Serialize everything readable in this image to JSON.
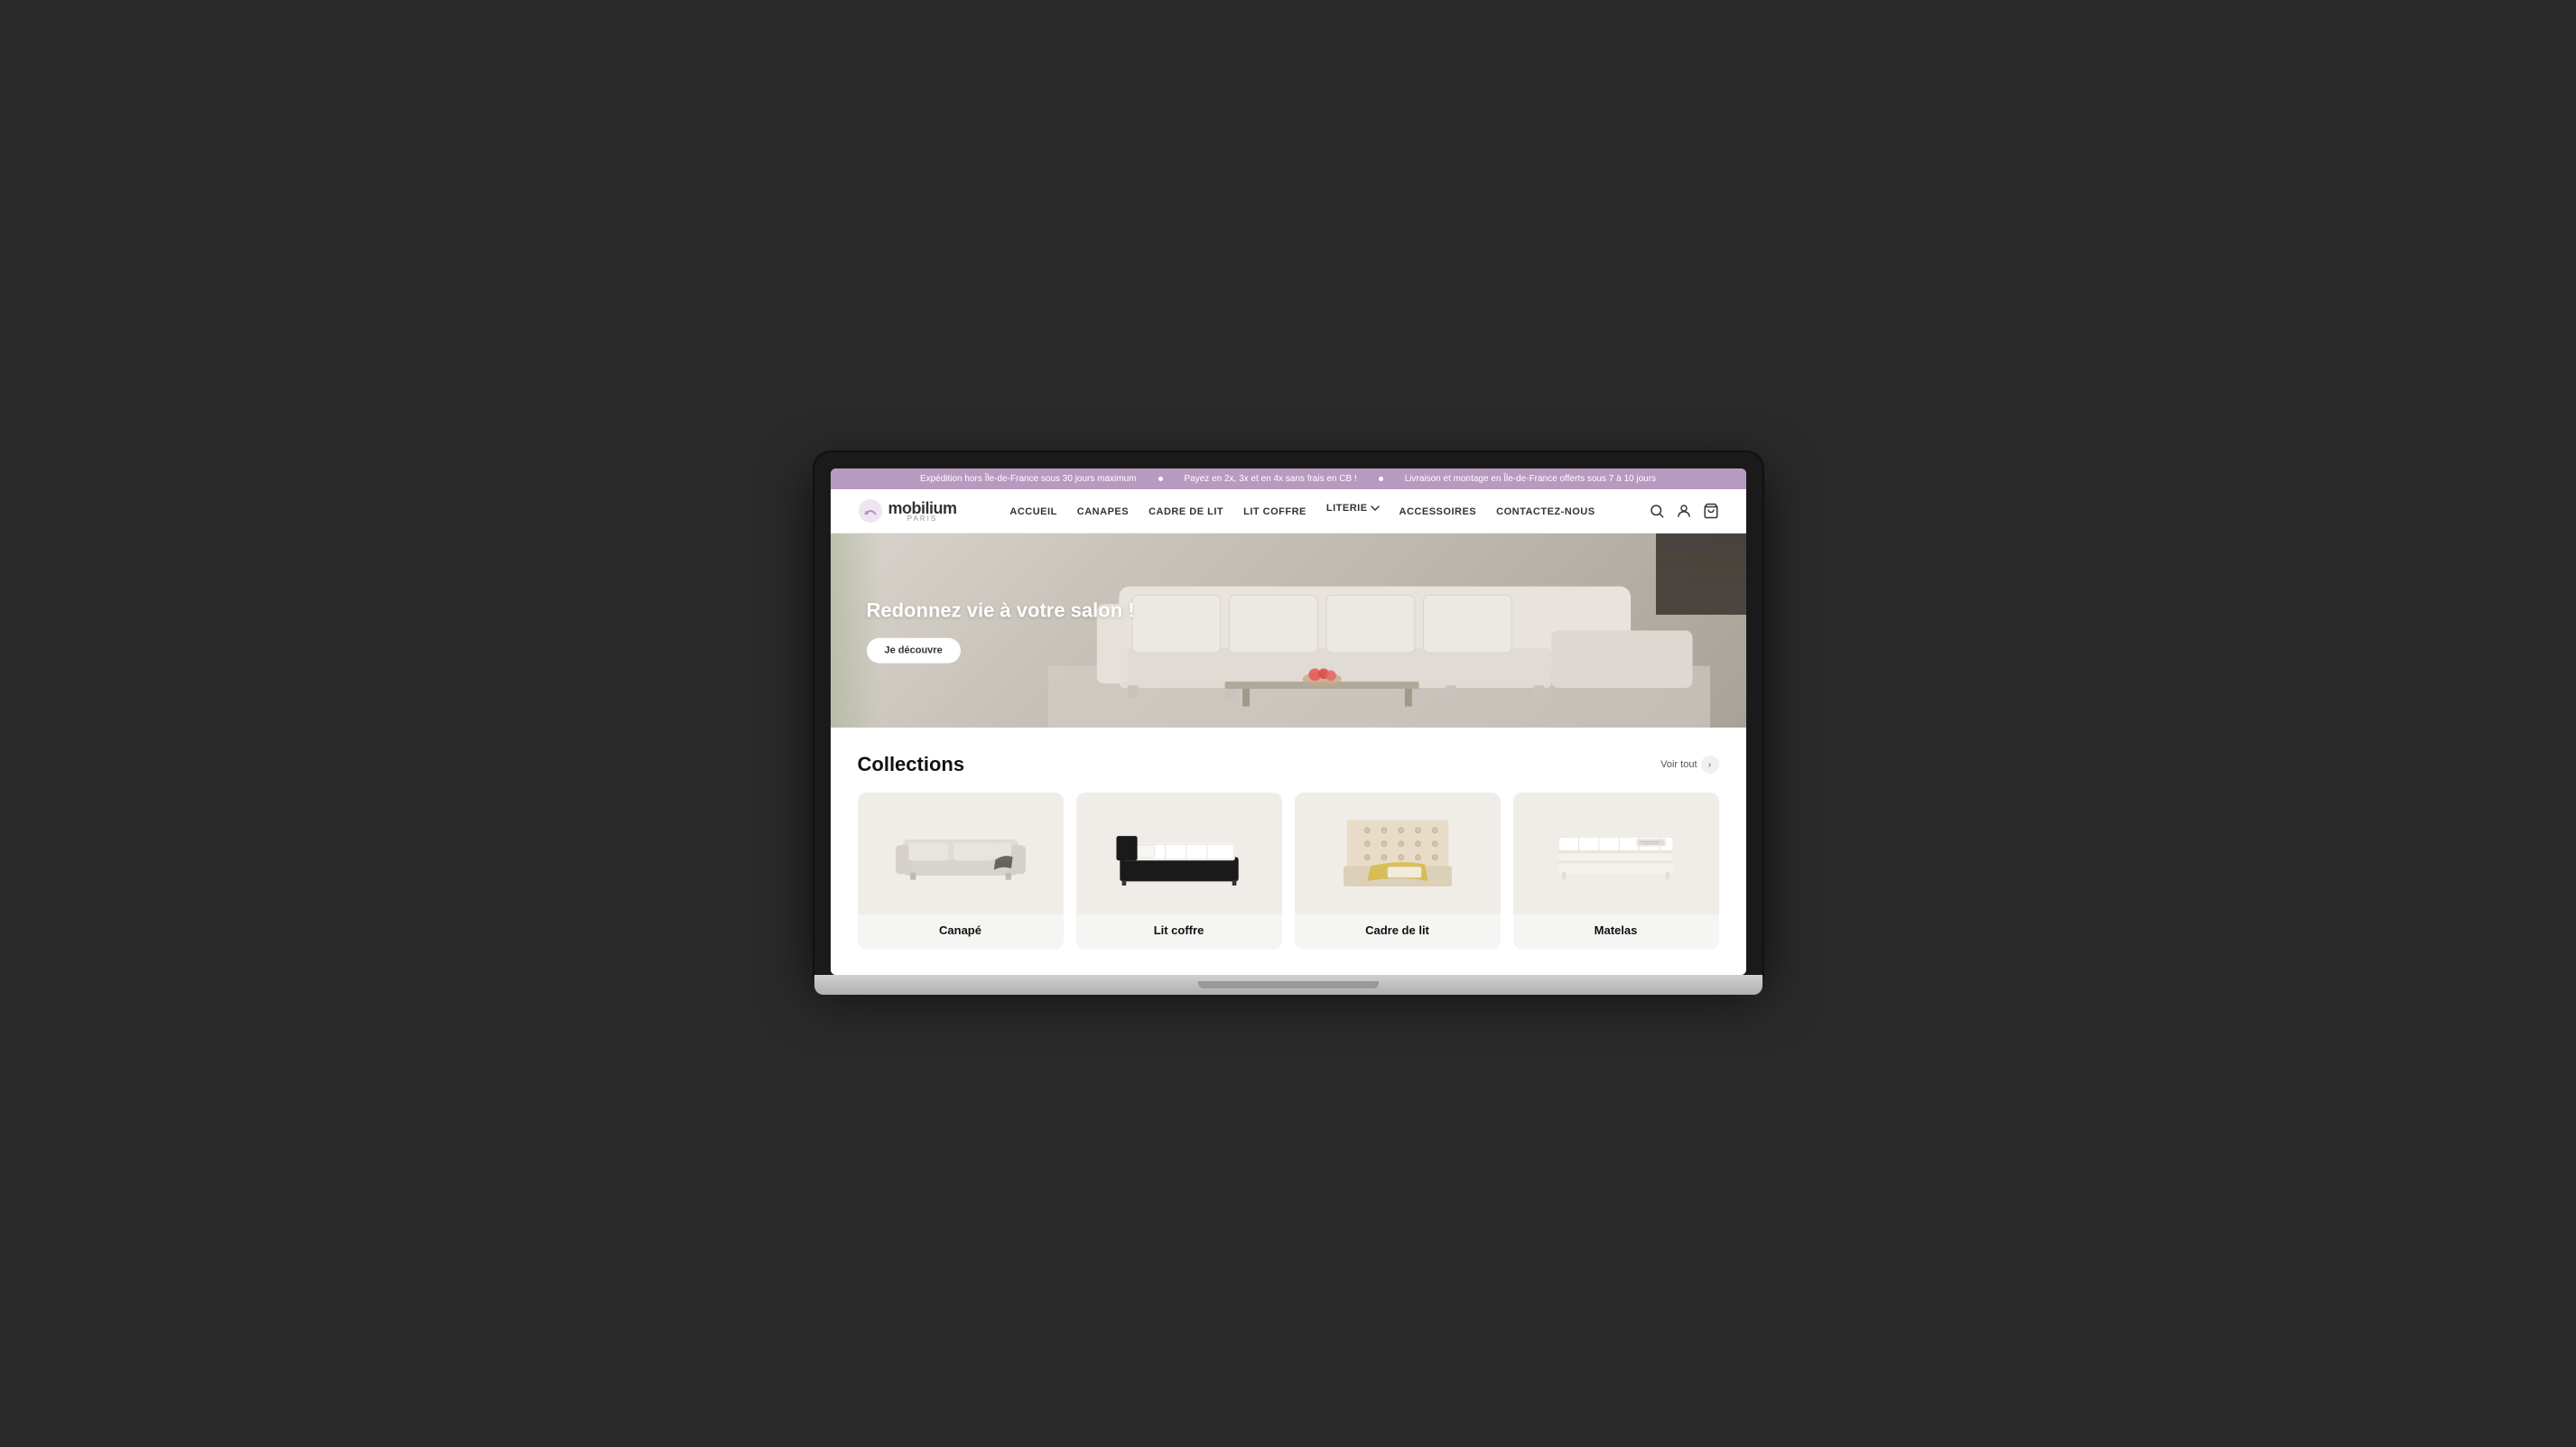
{
  "site": {
    "logo_text": "mobilium",
    "logo_sub": "PARIS"
  },
  "promo_banner": {
    "messages": [
      "Expédition hors Île-de-France sous 30 jours maximum",
      "Payez en 2x, 3x et en 4x sans frais en CB !",
      "Livraison et montage en Île-de-France offerts sous 7 à 10 jours"
    ]
  },
  "nav": {
    "links": [
      {
        "label": "ACCUEIL",
        "has_dropdown": false
      },
      {
        "label": "CANAPES",
        "has_dropdown": false
      },
      {
        "label": "CADRE DE LIT",
        "has_dropdown": false
      },
      {
        "label": "LIT COFFRE",
        "has_dropdown": false
      },
      {
        "label": "LITERIE",
        "has_dropdown": true
      },
      {
        "label": "ACCESSOIRES",
        "has_dropdown": false
      },
      {
        "label": "CONTACTEZ-NOUS",
        "has_dropdown": false
      }
    ]
  },
  "hero": {
    "title": "Redonnez vie à votre salon !",
    "cta_label": "Je découvre"
  },
  "collections": {
    "section_title": "Collections",
    "voir_tout_label": "Voir tout",
    "items": [
      {
        "id": "canape",
        "label": "Canapé"
      },
      {
        "id": "lit-coffre",
        "label": "Lit coffre"
      },
      {
        "id": "cadre-de-lit",
        "label": "Cadre de lit"
      },
      {
        "id": "matelas",
        "label": "Matelas"
      }
    ]
  },
  "icons": {
    "search": "&#128269;",
    "account": "&#128100;",
    "cart": "&#128722;"
  }
}
